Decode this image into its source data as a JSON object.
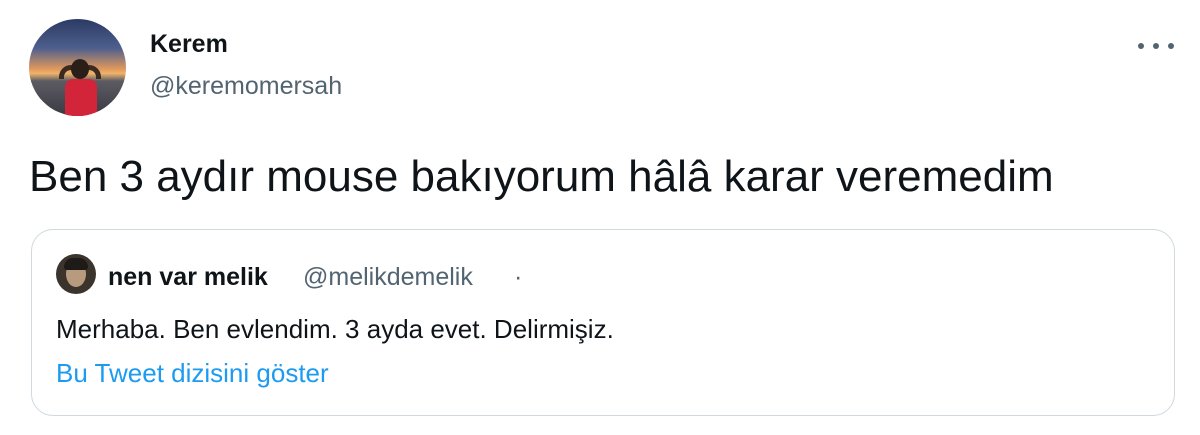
{
  "author": {
    "display_name": "Kerem",
    "handle": "@keremomersah",
    "avatar_icon": "profile-photo"
  },
  "tweet": {
    "text": "Ben 3 aydır mouse bakıyorum hâlâ karar veremedim"
  },
  "more_icon": "more-horizontal-icon",
  "quoted_tweet": {
    "display_name": "nen var melik",
    "handle": "@melikdemelik",
    "separator": "·",
    "text": "Merhaba. Ben evlendim. 3 ayda evet. Delirmişiz.",
    "show_thread_link": "Bu Tweet dizisini göster"
  },
  "colors": {
    "text_primary": "#0f1419",
    "text_secondary": "#536471",
    "link": "#1d9bf0",
    "border": "#cfd9de"
  }
}
